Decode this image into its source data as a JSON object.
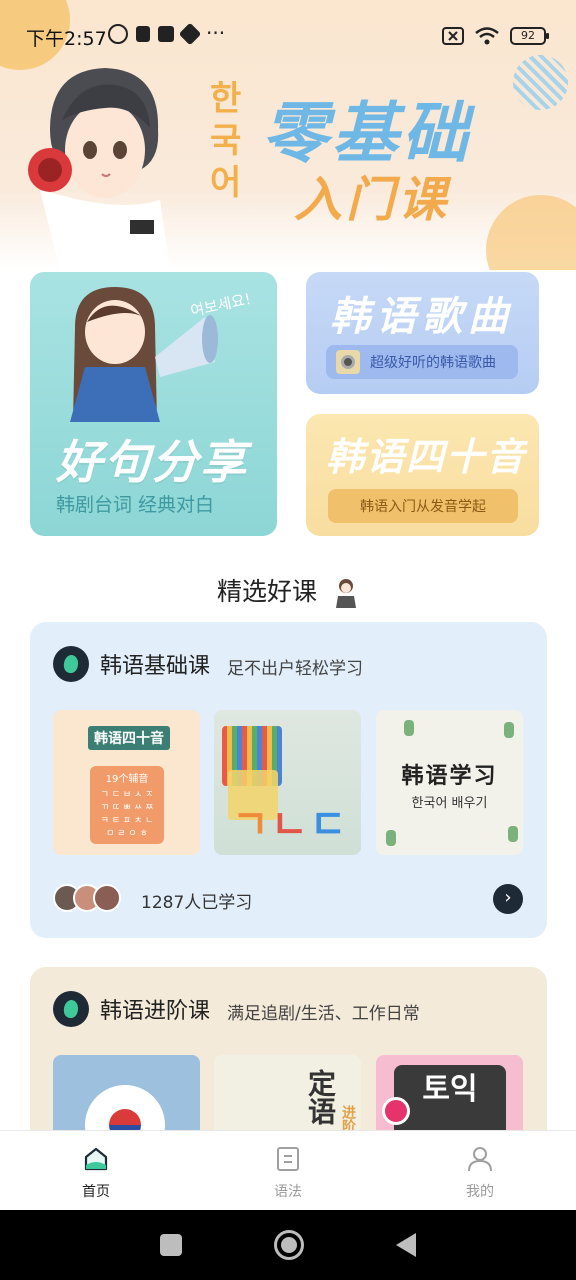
{
  "status_bar": {
    "time": "下午2:57",
    "battery": "92",
    "left_icons": [
      "mute-icon",
      "trash-icon",
      "upload-icon",
      "app-icon",
      "more-dots-icon"
    ],
    "right_icons": [
      "sim-off-icon",
      "wifi-icon",
      "battery-icon"
    ]
  },
  "hero": {
    "korean": [
      "한",
      "국",
      "어"
    ],
    "title": "零基础",
    "subtitle": "入门课"
  },
  "features": {
    "share": {
      "title": "好句分享",
      "subtitle": "韩剧台词 经典对白",
      "bubble": "여보세요!"
    },
    "songs": {
      "title": "韩语歌曲",
      "pill": "超级好听的韩语歌曲"
    },
    "forty": {
      "title": "韩语四十音",
      "pill": "韩语入门从发音学起"
    }
  },
  "section": {
    "title": "精选好课"
  },
  "courses": [
    {
      "name": "韩语基础课",
      "desc": "足不出户轻松学习",
      "thumbs": {
        "t1_tag": "韩语四十音",
        "t1_box_title": "19个辅音",
        "t1_box_lines": "ㄱ ㄷ ㅂ ㅅ ㅈ\nㄲ ㄸ ㅃ ㅆ ㅉ\nㅋ ㅌ ㅍ ㅊ ㄴ\nㅁ ㄹ ㅇ ㅎ",
        "t2_letters": [
          "ㄱ",
          "ㄴ",
          "ㄷ"
        ],
        "t3_title": "韩语学习",
        "t3_sub": "한국어 배우기"
      },
      "learners": "1287人已学习"
    },
    {
      "name": "韩语进阶课",
      "desc": "满足追剧/生活、工作日常",
      "thumbs": {
        "t2_text": "定语",
        "t2_tag": "进阶",
        "t3_text": "토익"
      }
    }
  ],
  "tabs": [
    {
      "label": "首页",
      "icon": "home-icon",
      "active": true
    },
    {
      "label": "语法",
      "icon": "grammar-icon",
      "active": false
    },
    {
      "label": "我的",
      "icon": "profile-icon",
      "active": false
    }
  ],
  "colors": {
    "accent": "#1f2a37",
    "flame": "#3fc99a",
    "basic_card": "#e2eef9",
    "advanced_card": "#f3ead9"
  }
}
